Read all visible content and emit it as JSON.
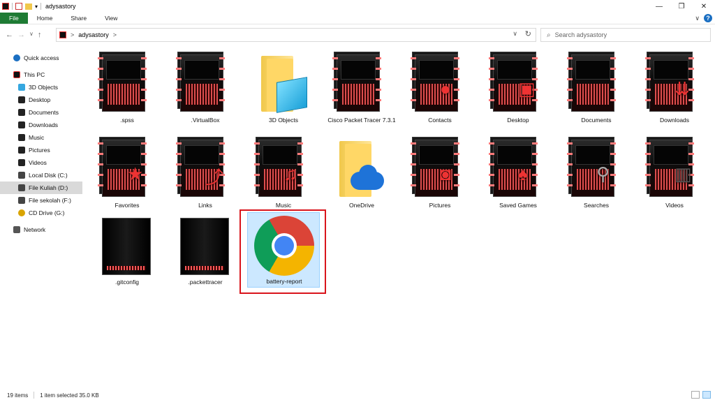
{
  "window": {
    "title": "adysastory",
    "controls": {
      "minimize": "—",
      "maximize": "❐",
      "close": "✕"
    }
  },
  "ribbon": {
    "tabs": [
      "File",
      "Home",
      "Share",
      "View"
    ],
    "help_label": "?",
    "expand_label": "∨"
  },
  "navigation": {
    "back": "←",
    "forward": "→",
    "recent": "∨",
    "up": "↑"
  },
  "address": {
    "crumbs": [
      "adysastory"
    ],
    "separator": ">",
    "dropdown": "∨",
    "refresh": "↻"
  },
  "search": {
    "placeholder": "Search adysastory",
    "icon": "search-icon"
  },
  "sidebar": {
    "items": [
      {
        "label": "Quick access",
        "icon": "star-icon",
        "color": "#1b6fc2"
      },
      {
        "label": "This PC",
        "icon": "computer-icon",
        "color": "#333333"
      },
      {
        "label": "3D Objects",
        "icon": "cube-icon",
        "color": "#35a7e0"
      },
      {
        "label": "Desktop",
        "icon": "desktop-icon",
        "color": "#222222"
      },
      {
        "label": "Documents",
        "icon": "documents-icon",
        "color": "#222222"
      },
      {
        "label": "Downloads",
        "icon": "downloads-icon",
        "color": "#222222"
      },
      {
        "label": "Music",
        "icon": "music-icon",
        "color": "#222222"
      },
      {
        "label": "Pictures",
        "icon": "pictures-icon",
        "color": "#222222"
      },
      {
        "label": "Videos",
        "icon": "videos-icon",
        "color": "#222222"
      },
      {
        "label": "Local Disk (C:)",
        "icon": "disk-icon",
        "color": "#444444"
      },
      {
        "label": "File Kuliah (D:)",
        "icon": "disk-icon",
        "color": "#444444"
      },
      {
        "label": "File sekolah (F:)",
        "icon": "disk-icon",
        "color": "#444444"
      },
      {
        "label": "CD Drive (G:)",
        "icon": "cd-icon",
        "color": "#d9a400"
      },
      {
        "label": "Network",
        "icon": "network-icon",
        "color": "#555555"
      }
    ]
  },
  "files": [
    {
      "label": ".spss",
      "icon": "dark-folder-icon"
    },
    {
      "label": ".VirtualBox",
      "icon": "dark-folder-icon"
    },
    {
      "label": "3D Objects",
      "icon": "3d-objects-folder-icon"
    },
    {
      "label": "Cisco Packet Tracer 7.3.1",
      "icon": "dark-folder-icon"
    },
    {
      "label": "Contacts",
      "icon": "dark-folder-contacts-icon"
    },
    {
      "label": "Desktop",
      "icon": "dark-folder-desktop-icon"
    },
    {
      "label": "Documents",
      "icon": "dark-folder-icon"
    },
    {
      "label": "Downloads",
      "icon": "dark-folder-downloads-icon"
    },
    {
      "label": "Favorites",
      "icon": "dark-folder-star-icon"
    },
    {
      "label": "Links",
      "icon": "dark-folder-links-icon"
    },
    {
      "label": "Music",
      "icon": "dark-folder-music-icon"
    },
    {
      "label": "OneDrive",
      "icon": "onedrive-folder-icon"
    },
    {
      "label": "Pictures",
      "icon": "dark-folder-pictures-icon"
    },
    {
      "label": "Saved Games",
      "icon": "dark-folder-games-icon"
    },
    {
      "label": "Searches",
      "icon": "dark-folder-search-icon"
    },
    {
      "label": "Videos",
      "icon": "dark-folder-videos-icon"
    },
    {
      "label": ".gitconfig",
      "icon": "config-file-icon"
    },
    {
      "label": ".packettracer",
      "icon": "config-file-icon"
    },
    {
      "label": "battery-report",
      "icon": "chrome-icon",
      "selected": true
    }
  ],
  "status": {
    "items_count": "19 items",
    "selection": "1 item selected  35.0 KB"
  },
  "colors": {
    "file_tab": "#1e7b34",
    "selection_bg": "#cce8ff",
    "highlight": "#d9141b"
  }
}
